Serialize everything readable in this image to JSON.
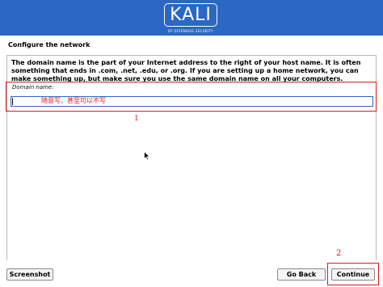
{
  "header": {
    "logo_text": "KALI",
    "logo_subtext": "BY OFFENSIVE SECURITY",
    "banner_color": "#2b67c4"
  },
  "page": {
    "title": "Configure the network",
    "description": "The domain name is the part of your Internet address to the right of your host name.  It is often something that ends in .com, .net, .edu, or .org.  If you are setting up a home network, you can make something up, but make sure you use the same domain name on all your computers."
  },
  "form": {
    "domain_label": "Domain name:",
    "domain_value": "",
    "handwritten_note": "随意写，甚至可以不写"
  },
  "annotations": {
    "marker_1": "1",
    "marker_2": "2",
    "color": "#e01818"
  },
  "buttons": {
    "screenshot": "Screenshot",
    "go_back": "Go Back",
    "continue": "Continue"
  }
}
